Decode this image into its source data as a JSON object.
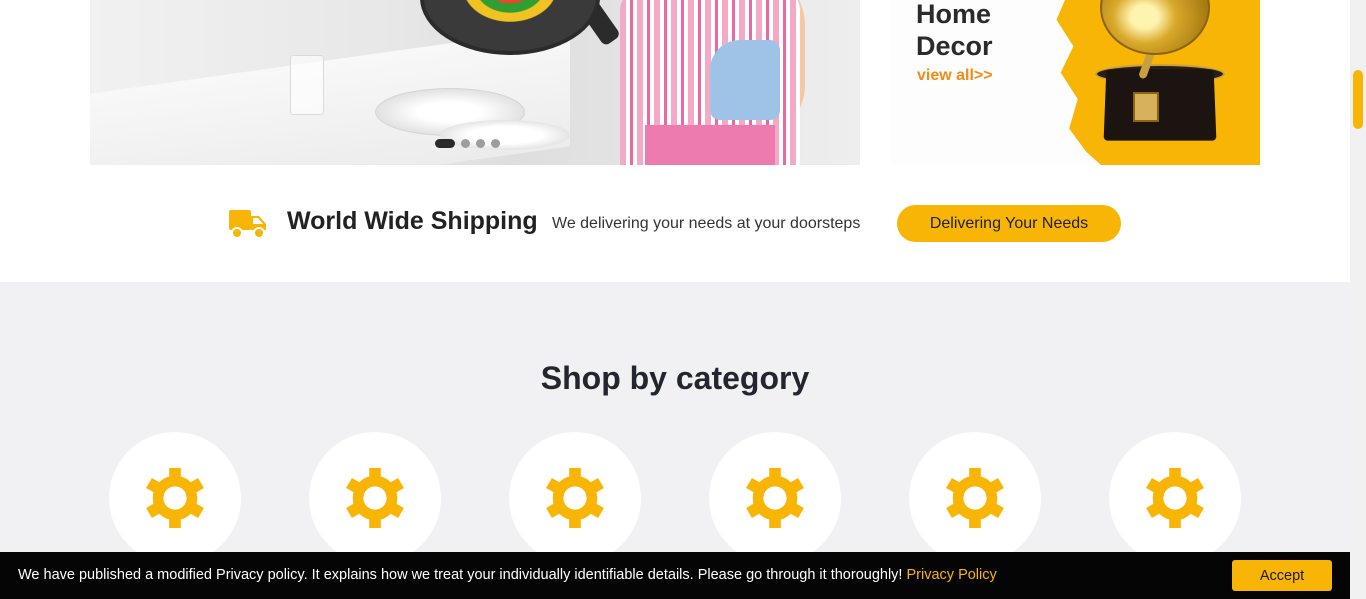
{
  "hero": {
    "slider_dots": [
      {
        "active": true
      },
      {
        "active": false
      },
      {
        "active": false
      },
      {
        "active": false
      }
    ]
  },
  "side_banner": {
    "title_line1": "Home",
    "title_line2": "Decor",
    "link_text": "view all>>"
  },
  "shipping": {
    "icon": "truck-icon",
    "title": "World Wide Shipping",
    "subtitle": "We delivering your needs at your doorsteps",
    "button_label": "Delivering Your Needs"
  },
  "categories": {
    "heading": "Shop by category",
    "items": [
      {
        "icon": "gear-icon"
      },
      {
        "icon": "gear-icon"
      },
      {
        "icon": "gear-icon"
      },
      {
        "icon": "gear-icon"
      },
      {
        "icon": "gear-icon"
      },
      {
        "icon": "gear-icon"
      }
    ]
  },
  "cookie_bar": {
    "message": "We have published a modified Privacy policy. It explains how we treat your individually identifiable details. Please go through it thoroughly! ",
    "link_text": "Privacy Policy",
    "accept_label": "Accept"
  },
  "colors": {
    "accent": "#f9b506",
    "category_background": "#f1f1f3",
    "cookie_bar_background": "#050505",
    "text_dark": "#222222"
  }
}
